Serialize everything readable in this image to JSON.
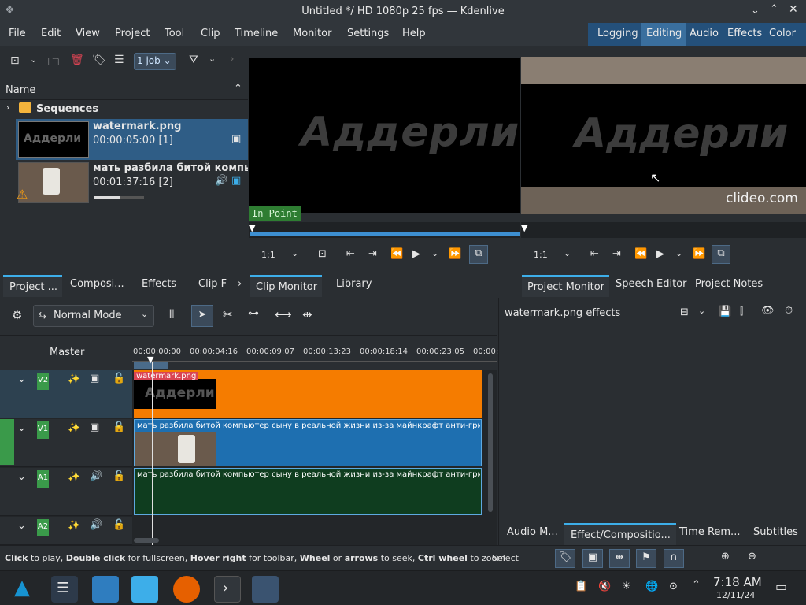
{
  "window": {
    "title": "Untitled */ HD 1080p 25 fps — Kdenlive"
  },
  "menu": [
    "File",
    "Edit",
    "View",
    "Project",
    "Tool",
    "Clip",
    "Timeline",
    "Monitor",
    "Settings",
    "Help"
  ],
  "workspaces": [
    "Logging",
    "Editing",
    "Audio",
    "Effects",
    "Color"
  ],
  "workspace_active": "Editing",
  "bin": {
    "jobs_label": "1 job",
    "column_name": "Name",
    "sequences_label": "Sequences",
    "items": [
      {
        "name": "watermark.png",
        "meta": "00:00:05:00 [1]",
        "thumb_text": "Аддерли"
      },
      {
        "name": "мать разбила битой компьют",
        "meta": "00:01:37:16 [2]",
        "usage_progress": 0.52
      }
    ],
    "tabs": [
      "Project ...",
      "Composi...",
      "Effects",
      "Clip F"
    ]
  },
  "clip_monitor": {
    "watermark_text": "Аддерли",
    "inpoint_label": "In Point",
    "zoom_value": "1:1",
    "tabs": [
      "Clip Monitor",
      "Library"
    ]
  },
  "project_monitor": {
    "watermark_text": "Аддерли",
    "logo_text": "clideo.com",
    "zoom_value": "1:1",
    "tabs": [
      "Project Monitor",
      "Speech Editor",
      "Project Notes"
    ]
  },
  "timeline": {
    "mode_label": "Normal Mode",
    "master_label": "Master",
    "ruler": [
      "00:00:00:00",
      "00:00:04:16",
      "00:00:09:07",
      "00:00:13:23",
      "00:00:18:14",
      "00:00:23:05",
      "00:00:"
    ],
    "tracks": [
      {
        "label": "V2"
      },
      {
        "label": "V1"
      },
      {
        "label": "A1"
      },
      {
        "label": "A2"
      }
    ],
    "clips": {
      "v2_title": "watermark.png",
      "v2_thumb_text": "Аддерли",
      "v1_title": "мать разбила битой компьютер сыну в реальной жизни из-за майнкрафт анти-гри",
      "a1_title": "мать разбила битой компьютер сыну в реальной жизни из-за майнкрафт анти-гри"
    },
    "colors": {
      "v2": "#f57c00",
      "v1": "#1e6fb0",
      "a1": "#0f3d1f"
    }
  },
  "effects_panel": {
    "title": "watermark.png effects",
    "tabs": [
      "Audio M...",
      "Effect/Compositio...",
      "Time Rem...",
      "Subtitles"
    ]
  },
  "status": {
    "hint_parts": [
      "Click",
      " to play, ",
      "Double click",
      " for fullscreen, ",
      "Hover right",
      " for toolbar, ",
      "Wheel",
      " or ",
      "arrows",
      " to seek, ",
      "Ctrl wheel",
      " to zoom"
    ],
    "select_label": "Select"
  },
  "taskbar": {
    "time": "7:18 AM",
    "date": "12/11/24"
  }
}
